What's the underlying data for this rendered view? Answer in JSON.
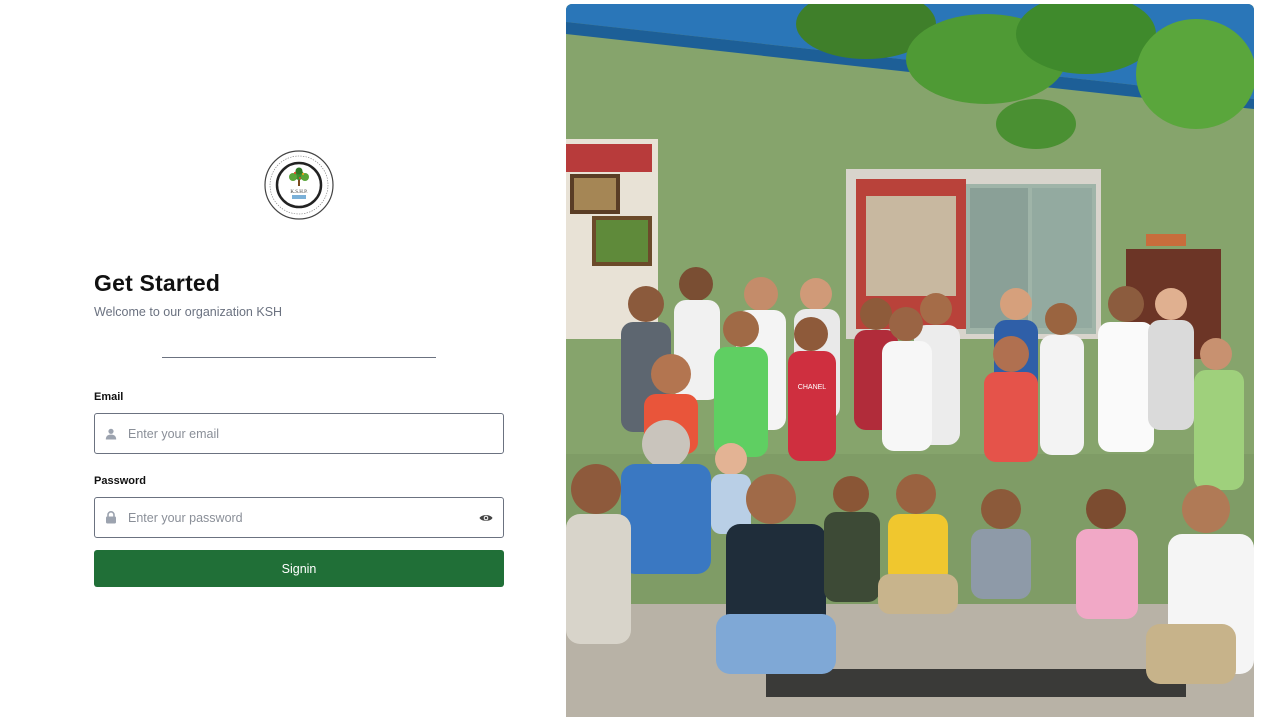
{
  "brand": {
    "logo_icon": "organization-seal-logo",
    "logo_text": "K.S.H.P."
  },
  "header": {
    "title": "Get Started",
    "subtitle": "Welcome to our organization KSH"
  },
  "form": {
    "email": {
      "label": "Email",
      "placeholder": "Enter your email",
      "value": "",
      "icon": "user-icon"
    },
    "password": {
      "label": "Password",
      "placeholder": "Enter your password",
      "value": "",
      "icon": "lock-icon",
      "toggle_icon": "eye-icon"
    },
    "submit_label": "Signin"
  },
  "hero": {
    "image": "group-photo",
    "chanel_shirt_text": "CHANEL"
  },
  "colors": {
    "primary": "#206f37",
    "input_border": "#6b7280",
    "placeholder": "#8a8f98",
    "subtitle": "#6b7280"
  }
}
